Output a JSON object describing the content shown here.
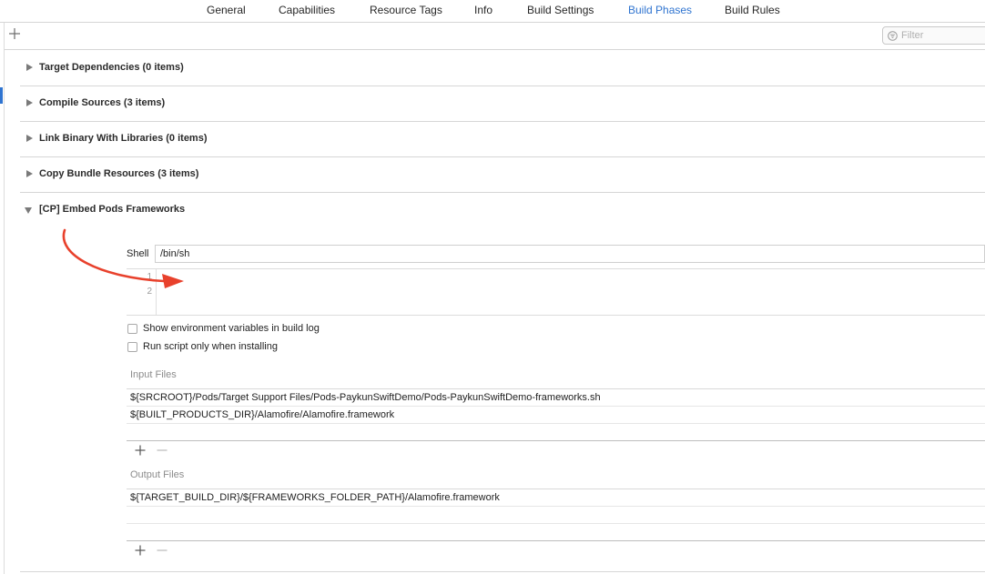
{
  "tabs": [
    {
      "label": "General",
      "active": false
    },
    {
      "label": "Capabilities",
      "active": false
    },
    {
      "label": "Resource Tags",
      "active": false
    },
    {
      "label": "Info",
      "active": false
    },
    {
      "label": "Build Settings",
      "active": false
    },
    {
      "label": "Build Phases",
      "active": true
    },
    {
      "label": "Build Rules",
      "active": false
    }
  ],
  "toolbar": {
    "add_icon": "plus-icon",
    "filter_placeholder": "Filter",
    "filter_value": "",
    "filter_icon": "filter-icon"
  },
  "phases": [
    {
      "title": "Target Dependencies (0 items)",
      "expanded": false
    },
    {
      "title": "Compile Sources (3 items)",
      "expanded": false
    },
    {
      "title": "Link Binary With Libraries (0 items)",
      "expanded": false
    },
    {
      "title": "Copy Bundle Resources (3 items)",
      "expanded": false
    },
    {
      "title": "[CP] Embed Pods Frameworks",
      "expanded": true
    }
  ],
  "run_script": {
    "shell_label": "Shell",
    "shell_value": "/bin/sh",
    "line_numbers": [
      "1",
      "2"
    ],
    "script_lines": [
      "",
      ""
    ],
    "options": [
      {
        "label": "Show environment variables in build log",
        "checked": false
      },
      {
        "label": "Run script only when installing",
        "checked": false
      }
    ],
    "input_files_label": "Input Files",
    "input_files": [
      "${SRCROOT}/Pods/Target Support Files/Pods-PaykunSwiftDemo/Pods-PaykunSwiftDemo-frameworks.sh",
      "${BUILT_PRODUCTS_DIR}/Alamofire/Alamofire.framework"
    ],
    "output_files_label": "Output Files",
    "output_files": [
      "${TARGET_BUILD_DIR}/${FRAMEWORKS_FOLDER_PATH}/Alamofire.framework",
      ""
    ]
  },
  "colors": {
    "accent": "#2f74d0",
    "annotation_arrow": "#e8412c"
  }
}
